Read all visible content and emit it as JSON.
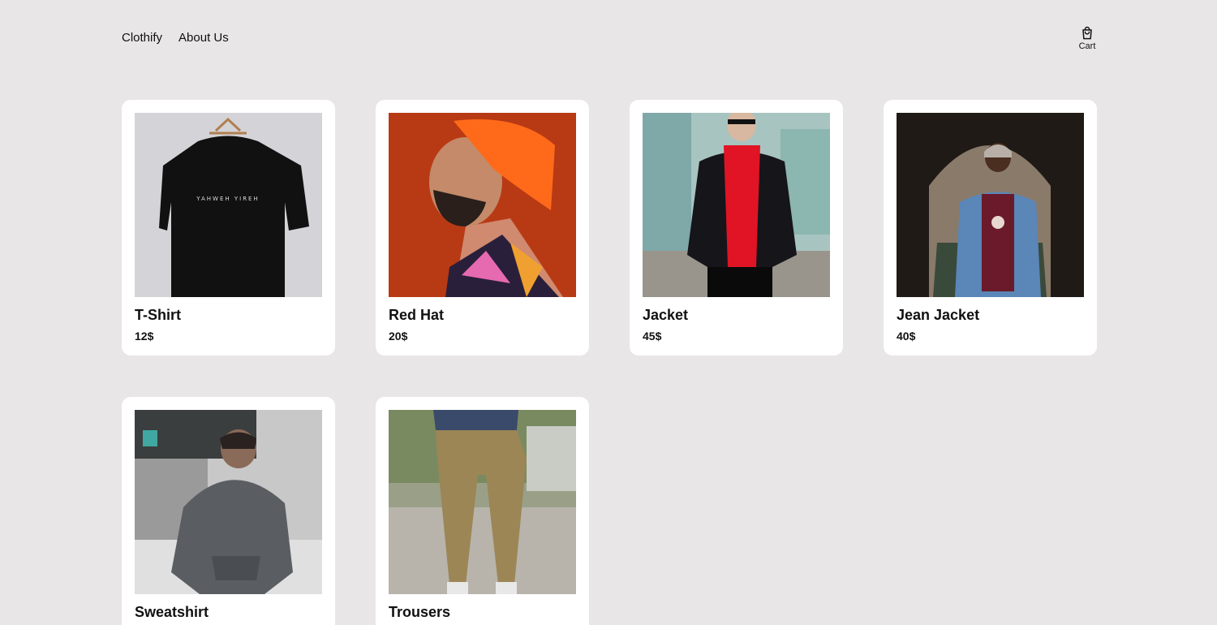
{
  "nav": {
    "brand": "Clothify",
    "about": "About Us"
  },
  "cart": {
    "label": "Cart",
    "icon": "shopping-bag-icon"
  },
  "products": [
    {
      "name": "T-Shirt",
      "price": "12$",
      "image": "t-shirt-photo"
    },
    {
      "name": "Red Hat",
      "price": "20$",
      "image": "red-hat-photo"
    },
    {
      "name": "Jacket",
      "price": "45$",
      "image": "jacket-photo"
    },
    {
      "name": "Jean Jacket",
      "price": "40$",
      "image": "jean-jacket-photo"
    },
    {
      "name": "Sweatshirt",
      "price": "",
      "image": "sweatshirt-photo"
    },
    {
      "name": "Trousers",
      "price": "",
      "image": "trousers-photo"
    }
  ]
}
